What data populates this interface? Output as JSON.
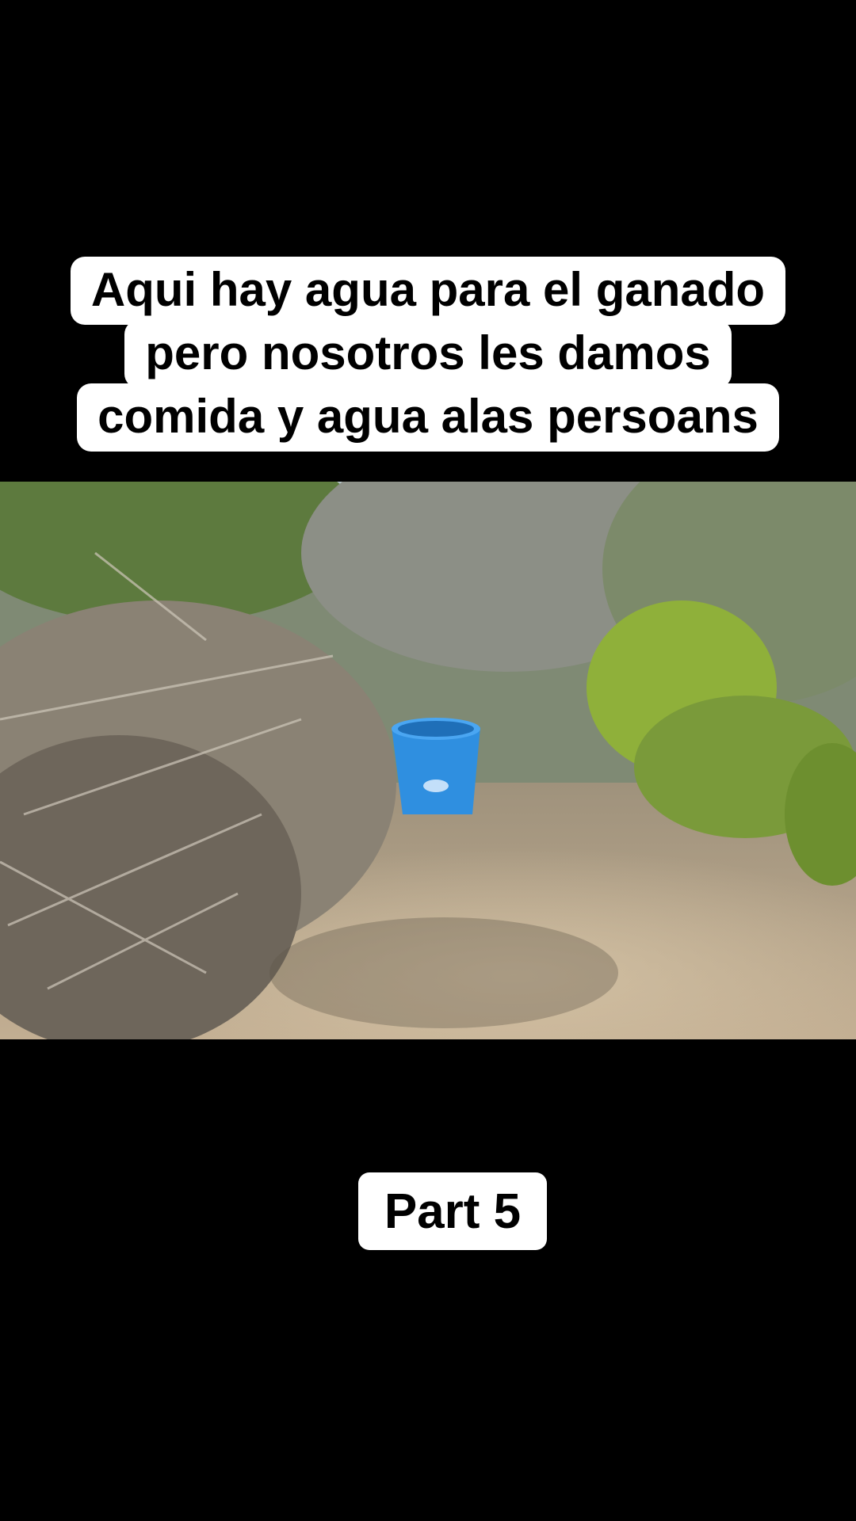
{
  "caption": {
    "lines": [
      "Aqui hay agua para el ganado",
      "pero nosotros les damos",
      "comida y agua alas persoans"
    ]
  },
  "video": {
    "scene_icon": "brush-scene-with-blue-bucket",
    "colors": {
      "bucket": "#2f8fe0",
      "foliage": "#7a9a3a",
      "brush": "#8d8477",
      "ground": "#b8a48a",
      "sky": "#cfe3f0"
    }
  },
  "part_label": "Part 5"
}
